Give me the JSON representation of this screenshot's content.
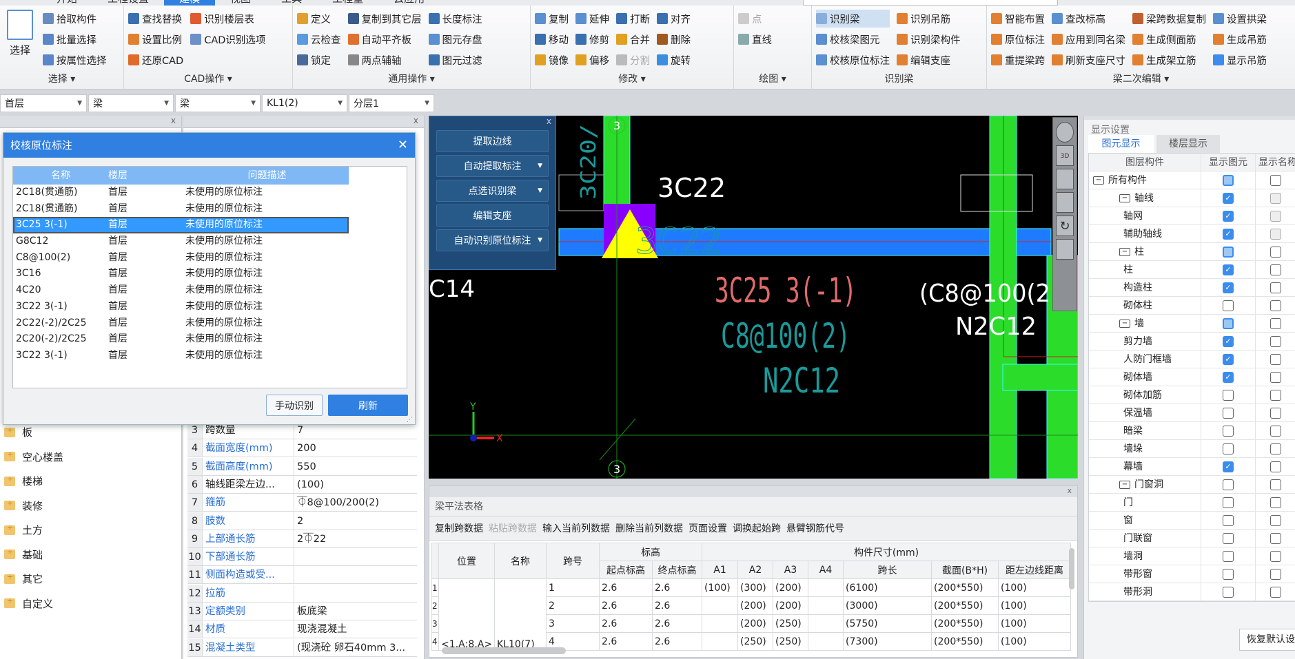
{
  "menu_tabs": [
    "开始",
    "工程设置",
    "建模",
    "视图",
    "工具",
    "工程量",
    "云应用"
  ],
  "active_tab": "建模",
  "ribbon": {
    "select": {
      "label": "选择",
      "big": "选择",
      "items": [
        "拾取构件",
        "批量选择",
        "按属性选择"
      ]
    },
    "cad": {
      "label": "CAD操作",
      "items": [
        "查找替换",
        "设置比例",
        "还原CAD",
        "识别楼层表",
        "CAD识别选项"
      ]
    },
    "common": {
      "label": "通用操作",
      "items": [
        "定义",
        "云检查",
        "锁定",
        "复制到其它层",
        "自动平齐板",
        "两点辅轴",
        "长度标注",
        "图元存盘",
        "图元过滤"
      ]
    },
    "modify": {
      "label": "修改",
      "items": [
        "复制",
        "移动",
        "镜像",
        "延伸",
        "修剪",
        "偏移",
        "打断",
        "合并",
        "分割",
        "对齐",
        "删除",
        "旋转"
      ]
    },
    "draw": {
      "label": "绘图",
      "items": [
        "点",
        "直线"
      ]
    },
    "recognize_beam": {
      "label": "识别梁",
      "items": [
        "识别梁",
        "校核梁图元",
        "校核原位标注",
        "识别吊筋",
        "识别梁构件",
        "编辑支座"
      ]
    },
    "beam_edit": {
      "label": "梁二次编辑",
      "items": [
        "智能布置",
        "原位标注",
        "重提梁跨",
        "查改标高",
        "应用到同名梁",
        "刷新支座尺寸",
        "梁跨数据复制",
        "生成侧面筋",
        "生成架立筋",
        "设置拱梁",
        "生成吊筋",
        "显示吊筋"
      ]
    }
  },
  "selectors": [
    "首层",
    "梁",
    "梁",
    "KL1(2)",
    "分层1"
  ],
  "nav_tree": [
    "板",
    "空心楼盖",
    "楼梯",
    "装修",
    "土方",
    "基础",
    "其它",
    "自定义"
  ],
  "properties": [
    {
      "n": "3",
      "k": "跨数量",
      "v": "7",
      "blue": false
    },
    {
      "n": "4",
      "k": "截面宽度(mm)",
      "v": "200",
      "blue": true
    },
    {
      "n": "5",
      "k": "截面高度(mm)",
      "v": "550",
      "blue": true
    },
    {
      "n": "6",
      "k": "轴线距梁左边...",
      "v": "(100)",
      "blue": false
    },
    {
      "n": "7",
      "k": "箍筋",
      "v": "⏁8@100/200(2)",
      "blue": true
    },
    {
      "n": "8",
      "k": "肢数",
      "v": "2",
      "blue": true
    },
    {
      "n": "9",
      "k": "上部通长筋",
      "v": "2⏁22",
      "blue": true
    },
    {
      "n": "10",
      "k": "下部通长筋",
      "v": "",
      "blue": true
    },
    {
      "n": "11",
      "k": "侧面构造或受...",
      "v": "",
      "blue": true
    },
    {
      "n": "12",
      "k": "拉筋",
      "v": "",
      "blue": true
    },
    {
      "n": "13",
      "k": "定额类别",
      "v": "板底梁",
      "blue": true
    },
    {
      "n": "14",
      "k": "材质",
      "v": "现浇混凝土",
      "blue": true
    },
    {
      "n": "15",
      "k": "混凝土类型",
      "v": "(现浇砼 卵石40mm 3...",
      "blue": true
    }
  ],
  "dialog": {
    "title": "校核原位标注",
    "columns": [
      "名称",
      "楼层",
      "问题描述"
    ],
    "rows": [
      [
        "2C18(贯通筋)",
        "首层",
        "未使用的原位标注"
      ],
      [
        "2C18(贯通筋)",
        "首层",
        "未使用的原位标注"
      ],
      [
        "3C25 3(-1)",
        "首层",
        "未使用的原位标注"
      ],
      [
        "G8C12",
        "首层",
        "未使用的原位标注"
      ],
      [
        "C8@100(2)",
        "首层",
        "未使用的原位标注"
      ],
      [
        "3C16",
        "首层",
        "未使用的原位标注"
      ],
      [
        "4C20",
        "首层",
        "未使用的原位标注"
      ],
      [
        "3C22 3(-1)",
        "首层",
        "未使用的原位标注"
      ],
      [
        "2C22(-2)/2C25",
        "首层",
        "未使用的原位标注"
      ],
      [
        "2C20(-2)/2C25",
        "首层",
        "未使用的原位标注"
      ],
      [
        "3C22 3(-1)",
        "首层",
        "未使用的原位标注"
      ]
    ],
    "selected_index": 2,
    "manual_button": "手动识别",
    "refresh_button": "刷新",
    "accent": "#2f80e0"
  },
  "float_panel": {
    "buttons": [
      "提取边线",
      "自动提取标注",
      "点选识别梁",
      "编辑支座",
      "自动识别原位标注"
    ]
  },
  "canvas": {
    "texts": {
      "t1": "3C22",
      "t2": "3C25 3(-1)",
      "t3": "C8@100(2)",
      "t4": "N2C12",
      "t5": "C14",
      "t6": "(C8@100(2",
      "t7": "N2C12",
      "t8": "3C20/",
      "axis": "3",
      "x": "X",
      "y": "Y",
      "v3d": "3D"
    }
  },
  "bottom_table": {
    "title": "梁平法表格",
    "toolbar": [
      "复制跨数据",
      "粘贴跨数据",
      "输入当前列数据",
      "删除当前列数据",
      "页面设置",
      "调换起始跨",
      "悬臂钢筋代号"
    ],
    "disabled_tool": "粘贴跨数据",
    "headers": {
      "pos": "位置",
      "name": "名称",
      "span": "跨号",
      "elev": "标高",
      "dims": "构件尺寸(mm)",
      "start": "起点标高",
      "end": "终点标高",
      "a1": "A1",
      "a2": "A2",
      "a3": "A3",
      "a4": "A4",
      "len": "跨长",
      "sec": "截面(B*H)",
      "dist": "距左边线距离"
    },
    "position": "<1,A;8,A>",
    "name": "KL10(7)",
    "rows": [
      [
        "1",
        "1",
        "2.6",
        "2.6",
        "(100)",
        "(300)",
        "(200)",
        "",
        "(6100)",
        "(200*550)",
        "(100)"
      ],
      [
        "2",
        "2",
        "2.6",
        "2.6",
        "",
        "(200)",
        "(200)",
        "",
        "(3000)",
        "(200*550)",
        "(100)"
      ],
      [
        "3",
        "3",
        "2.6",
        "2.6",
        "",
        "(200)",
        "(250)",
        "",
        "(5750)",
        "(200*550)",
        "(100)"
      ],
      [
        "4",
        "4",
        "2.6",
        "2.6",
        "",
        "(250)",
        "(250)",
        "",
        "(7300)",
        "(200*550)",
        "(100)"
      ]
    ]
  },
  "display_settings": {
    "title": "显示设置",
    "tabs": [
      "图元显示",
      "楼层显示"
    ],
    "columns": [
      "图层构件",
      "显示图元",
      "显示名称"
    ],
    "rows": [
      {
        "name": "所有构件",
        "level": 0,
        "show": "partial",
        "label": "off"
      },
      {
        "name": "轴线",
        "level": 1,
        "show": "on",
        "label": "gray"
      },
      {
        "name": "轴网",
        "level": 2,
        "show": "on",
        "label": "gray"
      },
      {
        "name": "辅助轴线",
        "level": 2,
        "show": "on",
        "label": "gray"
      },
      {
        "name": "柱",
        "level": 1,
        "show": "partial",
        "label": "off"
      },
      {
        "name": "柱",
        "level": 2,
        "show": "on",
        "label": "off"
      },
      {
        "name": "构造柱",
        "level": 2,
        "show": "on",
        "label": "off"
      },
      {
        "name": "砌体柱",
        "level": 2,
        "show": "off",
        "label": "off"
      },
      {
        "name": "墙",
        "level": 1,
        "show": "partial",
        "label": "off"
      },
      {
        "name": "剪力墙",
        "level": 2,
        "show": "on",
        "label": "off"
      },
      {
        "name": "人防门框墙",
        "level": 2,
        "show": "on",
        "label": "off"
      },
      {
        "name": "砌体墙",
        "level": 2,
        "show": "on",
        "label": "off"
      },
      {
        "name": "砌体加筋",
        "level": 2,
        "show": "off",
        "label": "off"
      },
      {
        "name": "保温墙",
        "level": 2,
        "show": "off",
        "label": "off"
      },
      {
        "name": "暗梁",
        "level": 2,
        "show": "off",
        "label": "off"
      },
      {
        "name": "墙垛",
        "level": 2,
        "show": "off",
        "label": "off"
      },
      {
        "name": "幕墙",
        "level": 2,
        "show": "on",
        "label": "off"
      },
      {
        "name": "门窗洞",
        "level": 1,
        "show": "off",
        "label": "off"
      },
      {
        "name": "门",
        "level": 2,
        "show": "off",
        "label": "off"
      },
      {
        "name": "窗",
        "level": 2,
        "show": "off",
        "label": "off"
      },
      {
        "name": "门联窗",
        "level": 2,
        "show": "off",
        "label": "off"
      },
      {
        "name": "墙洞",
        "level": 2,
        "show": "off",
        "label": "off"
      },
      {
        "name": "带形窗",
        "level": 2,
        "show": "off",
        "label": "off"
      },
      {
        "name": "带形洞",
        "level": 2,
        "show": "off",
        "label": "off"
      }
    ],
    "restore_button": "恢复默认设置"
  }
}
